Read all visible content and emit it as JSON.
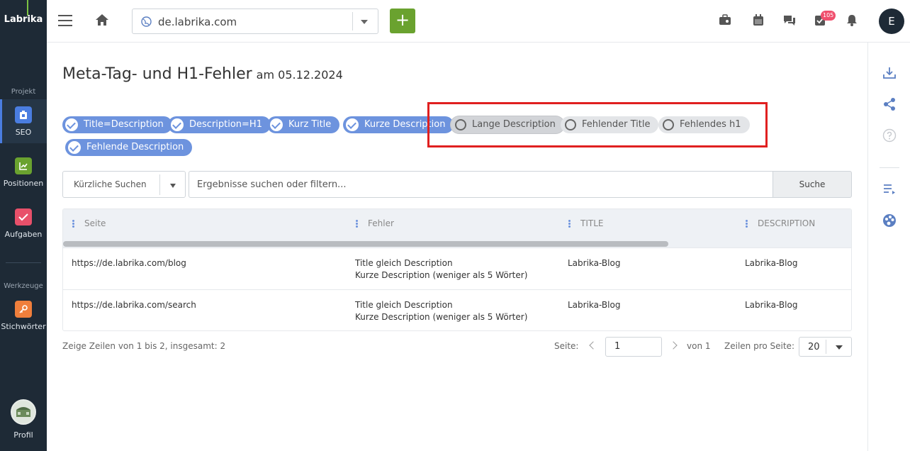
{
  "app": {
    "logo": "Labrika"
  },
  "sidebar": {
    "section_project": "Projekt",
    "section_tools": "Werkzeuge",
    "items": [
      {
        "label": "SEO",
        "color": "#4a7de0"
      },
      {
        "label": "Positionen",
        "color": "#6aa22f"
      },
      {
        "label": "Aufgaben",
        "color": "#e8506a"
      },
      {
        "label": "Stichwörter",
        "color": "#f07f3c"
      }
    ],
    "profile": "Profil"
  },
  "header": {
    "url": "de.labrika.com",
    "add_label": "+",
    "notification_count": "105",
    "user_initial": "E"
  },
  "page": {
    "title": "Meta-Tag- und H1-Fehler",
    "date": "am 05.12.2024"
  },
  "filters": {
    "active": [
      "Title=Description",
      "Description=H1",
      "Kurz Title",
      "Kurze Description",
      "Fehlende Description"
    ],
    "inactive": [
      "Lange Description",
      "Fehlender Title",
      "Fehlendes h1"
    ]
  },
  "search": {
    "recent_label": "Kürzliche Suchen",
    "placeholder": "Ergebnisse suchen oder filtern...",
    "button": "Suche"
  },
  "table": {
    "columns": [
      "Seite",
      "Fehler",
      "TITLE",
      "DESCRIPTION"
    ],
    "rows": [
      {
        "page": "https://de.labrika.com/blog",
        "error1": "Title gleich Description",
        "error2": "Kurze Description (weniger als 5 Wörter)",
        "title": "Labrika-Blog",
        "description": "Labrika-Blog"
      },
      {
        "page": "https://de.labrika.com/search",
        "error1": "Title gleich Description",
        "error2": "Kurze Description (weniger als 5 Wörter)",
        "title": "Labrika-Blog",
        "description": "Labrika-Blog"
      }
    ]
  },
  "footer": {
    "info": "Zeige Zeilen von 1 bis 2, insgesamt: 2",
    "page_label": "Seite:",
    "page_value": "1",
    "of_label": "von 1",
    "rows_label": "Zeilen pro Seite:",
    "rows_value": "20"
  },
  "colors": {
    "sidebar_bg": "#1e2a36",
    "chip_active": "#6d93de",
    "add_button": "#6aa22f",
    "highlight": "#e02020"
  }
}
